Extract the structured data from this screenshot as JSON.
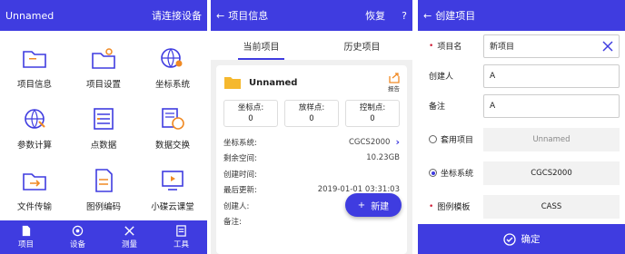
{
  "screen1": {
    "title": "Unnamed",
    "connect_label": "请连接设备",
    "grid": [
      {
        "label": "项目信息",
        "icon": "folder-icon"
      },
      {
        "label": "项目设置",
        "icon": "folder-settings-icon"
      },
      {
        "label": "坐标系统",
        "icon": "globe-location-icon"
      },
      {
        "label": "参数计算",
        "icon": "globe-arrows-icon"
      },
      {
        "label": "点数据",
        "icon": "point-list-icon"
      },
      {
        "label": "数据交换",
        "icon": "data-exchange-icon"
      },
      {
        "label": "文件传输",
        "icon": "file-transfer-icon"
      },
      {
        "label": "图例编码",
        "icon": "legend-code-icon"
      },
      {
        "label": "小碟云课堂",
        "icon": "video-classroom-icon"
      }
    ],
    "nav": [
      {
        "label": "项目",
        "icon": "project-icon"
      },
      {
        "label": "设备",
        "icon": "device-icon"
      },
      {
        "label": "测量",
        "icon": "measure-icon"
      },
      {
        "label": "工具",
        "icon": "tools-icon"
      }
    ]
  },
  "screen2": {
    "title": "项目信息",
    "restore_label": "恢复",
    "help_label": "?",
    "tabs": [
      "当前项目",
      "历史项目"
    ],
    "project_name": "Unnamed",
    "report_label": "报告",
    "points": [
      {
        "label": "坐标点:",
        "value": "0"
      },
      {
        "label": "放样点:",
        "value": "0"
      },
      {
        "label": "控制点:",
        "value": "0"
      }
    ],
    "info": [
      {
        "label": "坐标系统:",
        "value": "CGCS2000"
      },
      {
        "label": "剩余空间:",
        "value": "10.23GB"
      },
      {
        "label": "创建时间:",
        "value": ""
      },
      {
        "label": "最后更新:",
        "value": "2019-01-01 03:31:03"
      },
      {
        "label": "创建人:",
        "value": ""
      },
      {
        "label": "备注:",
        "value": ""
      }
    ],
    "new_label": "新建"
  },
  "screen3": {
    "title": "创建项目",
    "fields": {
      "name_label": "项目名",
      "name_value": "新项目",
      "creator_label": "创建人",
      "creator_value": "A",
      "note_label": "备注",
      "note_value": "A",
      "apply_label": "套用项目",
      "apply_value": "Unnamed",
      "coord_label": "坐标系统",
      "coord_value": "CGCS2000",
      "legend_label": "图例模板",
      "legend_value": "CASS"
    },
    "confirm_label": "确定"
  },
  "colors": {
    "primary": "#3f3ce0",
    "accent_orange": "#f08a24",
    "required_red": "#d0213a"
  }
}
